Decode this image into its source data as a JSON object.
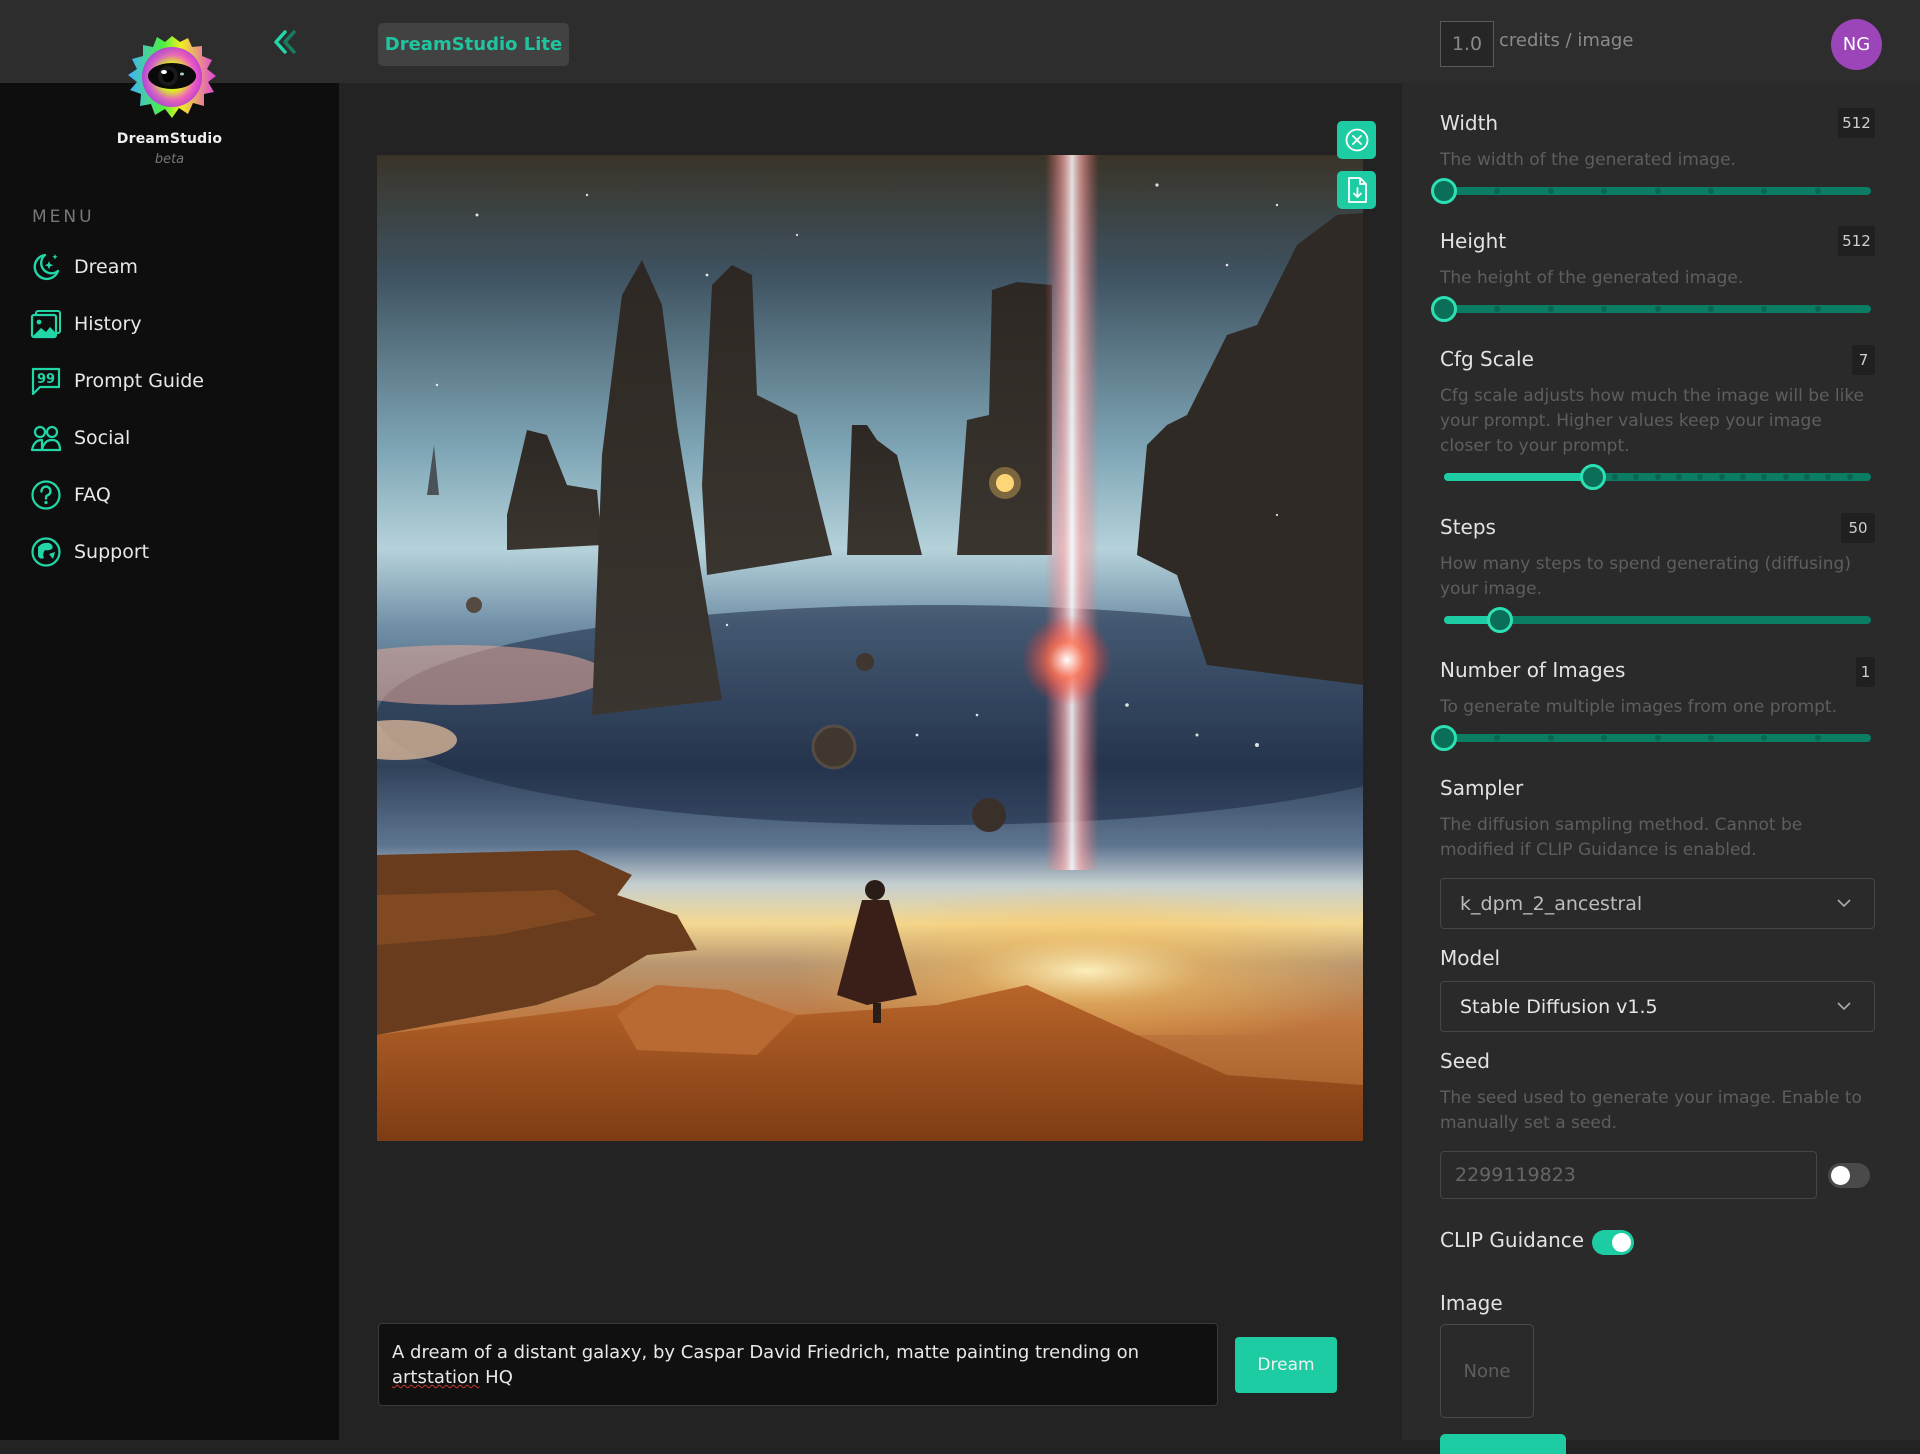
{
  "brand": {
    "name": "DreamStudio",
    "subtitle": "beta",
    "product_badge": "DreamStudio Lite"
  },
  "topbar": {
    "credits_value": "1.0",
    "credits_label": "credits / image",
    "avatar_initials": "NG"
  },
  "sidebar": {
    "menu_title": "MENU",
    "items": [
      {
        "label": "Dream",
        "icon": "moon-stars-icon"
      },
      {
        "label": "History",
        "icon": "images-icon"
      },
      {
        "label": "Prompt Guide",
        "icon": "quote-bubble-icon"
      },
      {
        "label": "Social",
        "icon": "users-icon"
      },
      {
        "label": "FAQ",
        "icon": "question-circle-icon"
      },
      {
        "label": "Support",
        "icon": "support-globe-icon"
      }
    ]
  },
  "main": {
    "image_actions": [
      {
        "name": "close-image",
        "icon": "close-circle-icon"
      },
      {
        "name": "download-image",
        "icon": "file-download-icon"
      }
    ],
    "prompt": {
      "value_before": "A dream of a distant galaxy, by Caspar David Friedrich, matte painting trending on ",
      "value_misspelled": "artstation",
      "value_after": " HQ"
    },
    "dream_button": "Dream"
  },
  "settings": {
    "width": {
      "label": "Width",
      "value": "512",
      "description": "The width of the generated image.",
      "fraction": 0.0,
      "ticks": 8
    },
    "height": {
      "label": "Height",
      "value": "512",
      "description": "The height of the generated image.",
      "fraction": 0.0,
      "ticks": 8
    },
    "cfg_scale": {
      "label": "Cfg Scale",
      "value": "7",
      "description": "Cfg scale adjusts how much the image will be like your prompt. Higher values keep your image closer to your prompt.",
      "fraction": 0.35,
      "ticks": 20
    },
    "steps": {
      "label": "Steps",
      "value": "50",
      "description": "How many steps to spend generating (diffusing) your image.",
      "fraction": 0.13,
      "ticks": 0
    },
    "num_images": {
      "label": "Number of Images",
      "value": "1",
      "description": "To generate multiple images from one prompt.",
      "fraction": 0.0,
      "ticks": 8
    },
    "sampler": {
      "label": "Sampler",
      "description": "The diffusion sampling method. Cannot be modified if CLIP Guidance is enabled.",
      "selected": "k_dpm_2_ancestral"
    },
    "model": {
      "label": "Model",
      "selected": "Stable Diffusion v1.5"
    },
    "seed": {
      "label": "Seed",
      "description": "The seed used to generate your image. Enable to manually set a seed.",
      "value": "2299119823",
      "manual_enabled": false
    },
    "clip_guidance": {
      "label": "CLIP Guidance",
      "enabled": true
    },
    "image": {
      "label": "Image",
      "value": "None"
    }
  },
  "colors": {
    "accent": "#1ecca3",
    "slider_track": "#0b7d62",
    "avatar": "#9b45b8",
    "sidebar_bg": "#0e0e0e",
    "panel_bg": "#2a2a2a"
  }
}
